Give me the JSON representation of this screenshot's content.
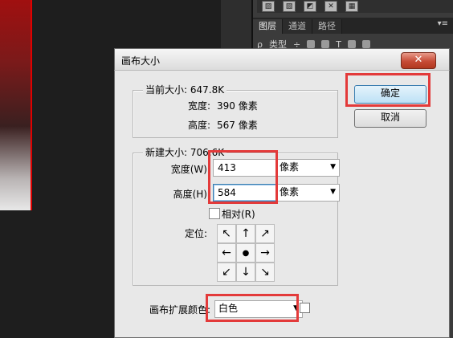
{
  "layers_panel": {
    "tabs": [
      "图层",
      "通道",
      "路径"
    ],
    "filter_label": "类型"
  },
  "dialog": {
    "title": "画布大小",
    "close_label": "✕",
    "ok_label": "确定",
    "cancel_label": "取消",
    "current_size": {
      "label": "当前大小: 647.8K",
      "width_label": "宽度:",
      "width_value": "390 像素",
      "height_label": "高度:",
      "height_value": "567 像素"
    },
    "new_size": {
      "label": "新建大小: 706.6K",
      "width_label": "宽度(W):",
      "width_value": "413",
      "width_unit": "像素",
      "height_label": "高度(H):",
      "height_value": "584",
      "height_unit": "像素",
      "relative_label": "相对(R)",
      "relative_checked": false,
      "anchor_label": "定位:",
      "anchor_arrows": [
        "↖",
        "↑",
        "↗",
        "←",
        "●",
        "→",
        "↙",
        "↓",
        "↘"
      ]
    },
    "extension_color_label": "画布扩展颜色:",
    "extension_color_value": "白色",
    "extension_swatch_color": "#ffffff"
  },
  "colors": {
    "highlight": "#e33a3a",
    "close_button": "#c64b36",
    "default_button_border": "#3c7fb1"
  }
}
